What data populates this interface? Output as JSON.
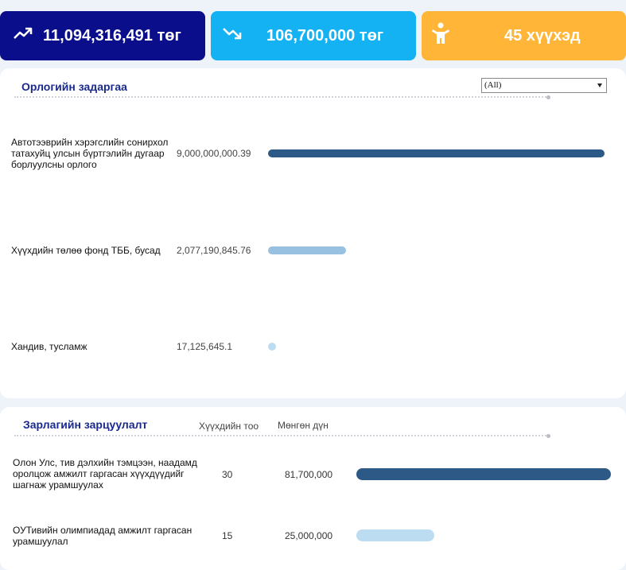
{
  "kpis": {
    "income": {
      "value": "11,094,316,491 төг",
      "icon": "trending-up-icon",
      "color": "#0a0e8a"
    },
    "expense": {
      "value": "106,700,000 төг",
      "icon": "trending-down-icon",
      "color": "#14b2f2"
    },
    "children": {
      "value": "45 хүүхэд",
      "icon": "child-icon",
      "color": "#ffb638"
    }
  },
  "income_panel": {
    "title": "Орлогийн задаргаа",
    "filter_value": "(All)",
    "rows": [
      {
        "label": "Автотээврийн хэрэгслийн сонирхол татахуйц улсын бүртгэлийн дугаар борлуулсны орлого",
        "value": "9,000,000,000.39",
        "amount": 9000000000.39,
        "color": "#2c5985"
      },
      {
        "label": "Хүүхдийн төлөө фонд ТББ, бусад",
        "value": "2,077,190,845.76",
        "amount": 2077190845.76,
        "color": "#97c0e1"
      },
      {
        "label": "Хандив, тусламж",
        "value": "17,125,645.1",
        "amount": 17125645.1,
        "color": "#bcdcf2"
      }
    ]
  },
  "expense_panel": {
    "title": "Зарлагийн зарцуулалт",
    "col_children": "Хүүхдийн тоо",
    "col_amount": "Мөнгөн дүн",
    "rows": [
      {
        "label": "Олон Улс, тив дэлхийн тэмцээн, наадамд оролцож амжилт гаргасан хүүхдүүдийг шагнаж урамшуулах",
        "children": "30",
        "value": "81,700,000",
        "amount": 81700000,
        "color": "#2c5985"
      },
      {
        "label": "ОУТивийн олимпиадад амжилт гаргасан урамшуулал",
        "children": "15",
        "value": "25,000,000",
        "amount": 25000000,
        "color": "#bcdcf2"
      }
    ]
  }
}
